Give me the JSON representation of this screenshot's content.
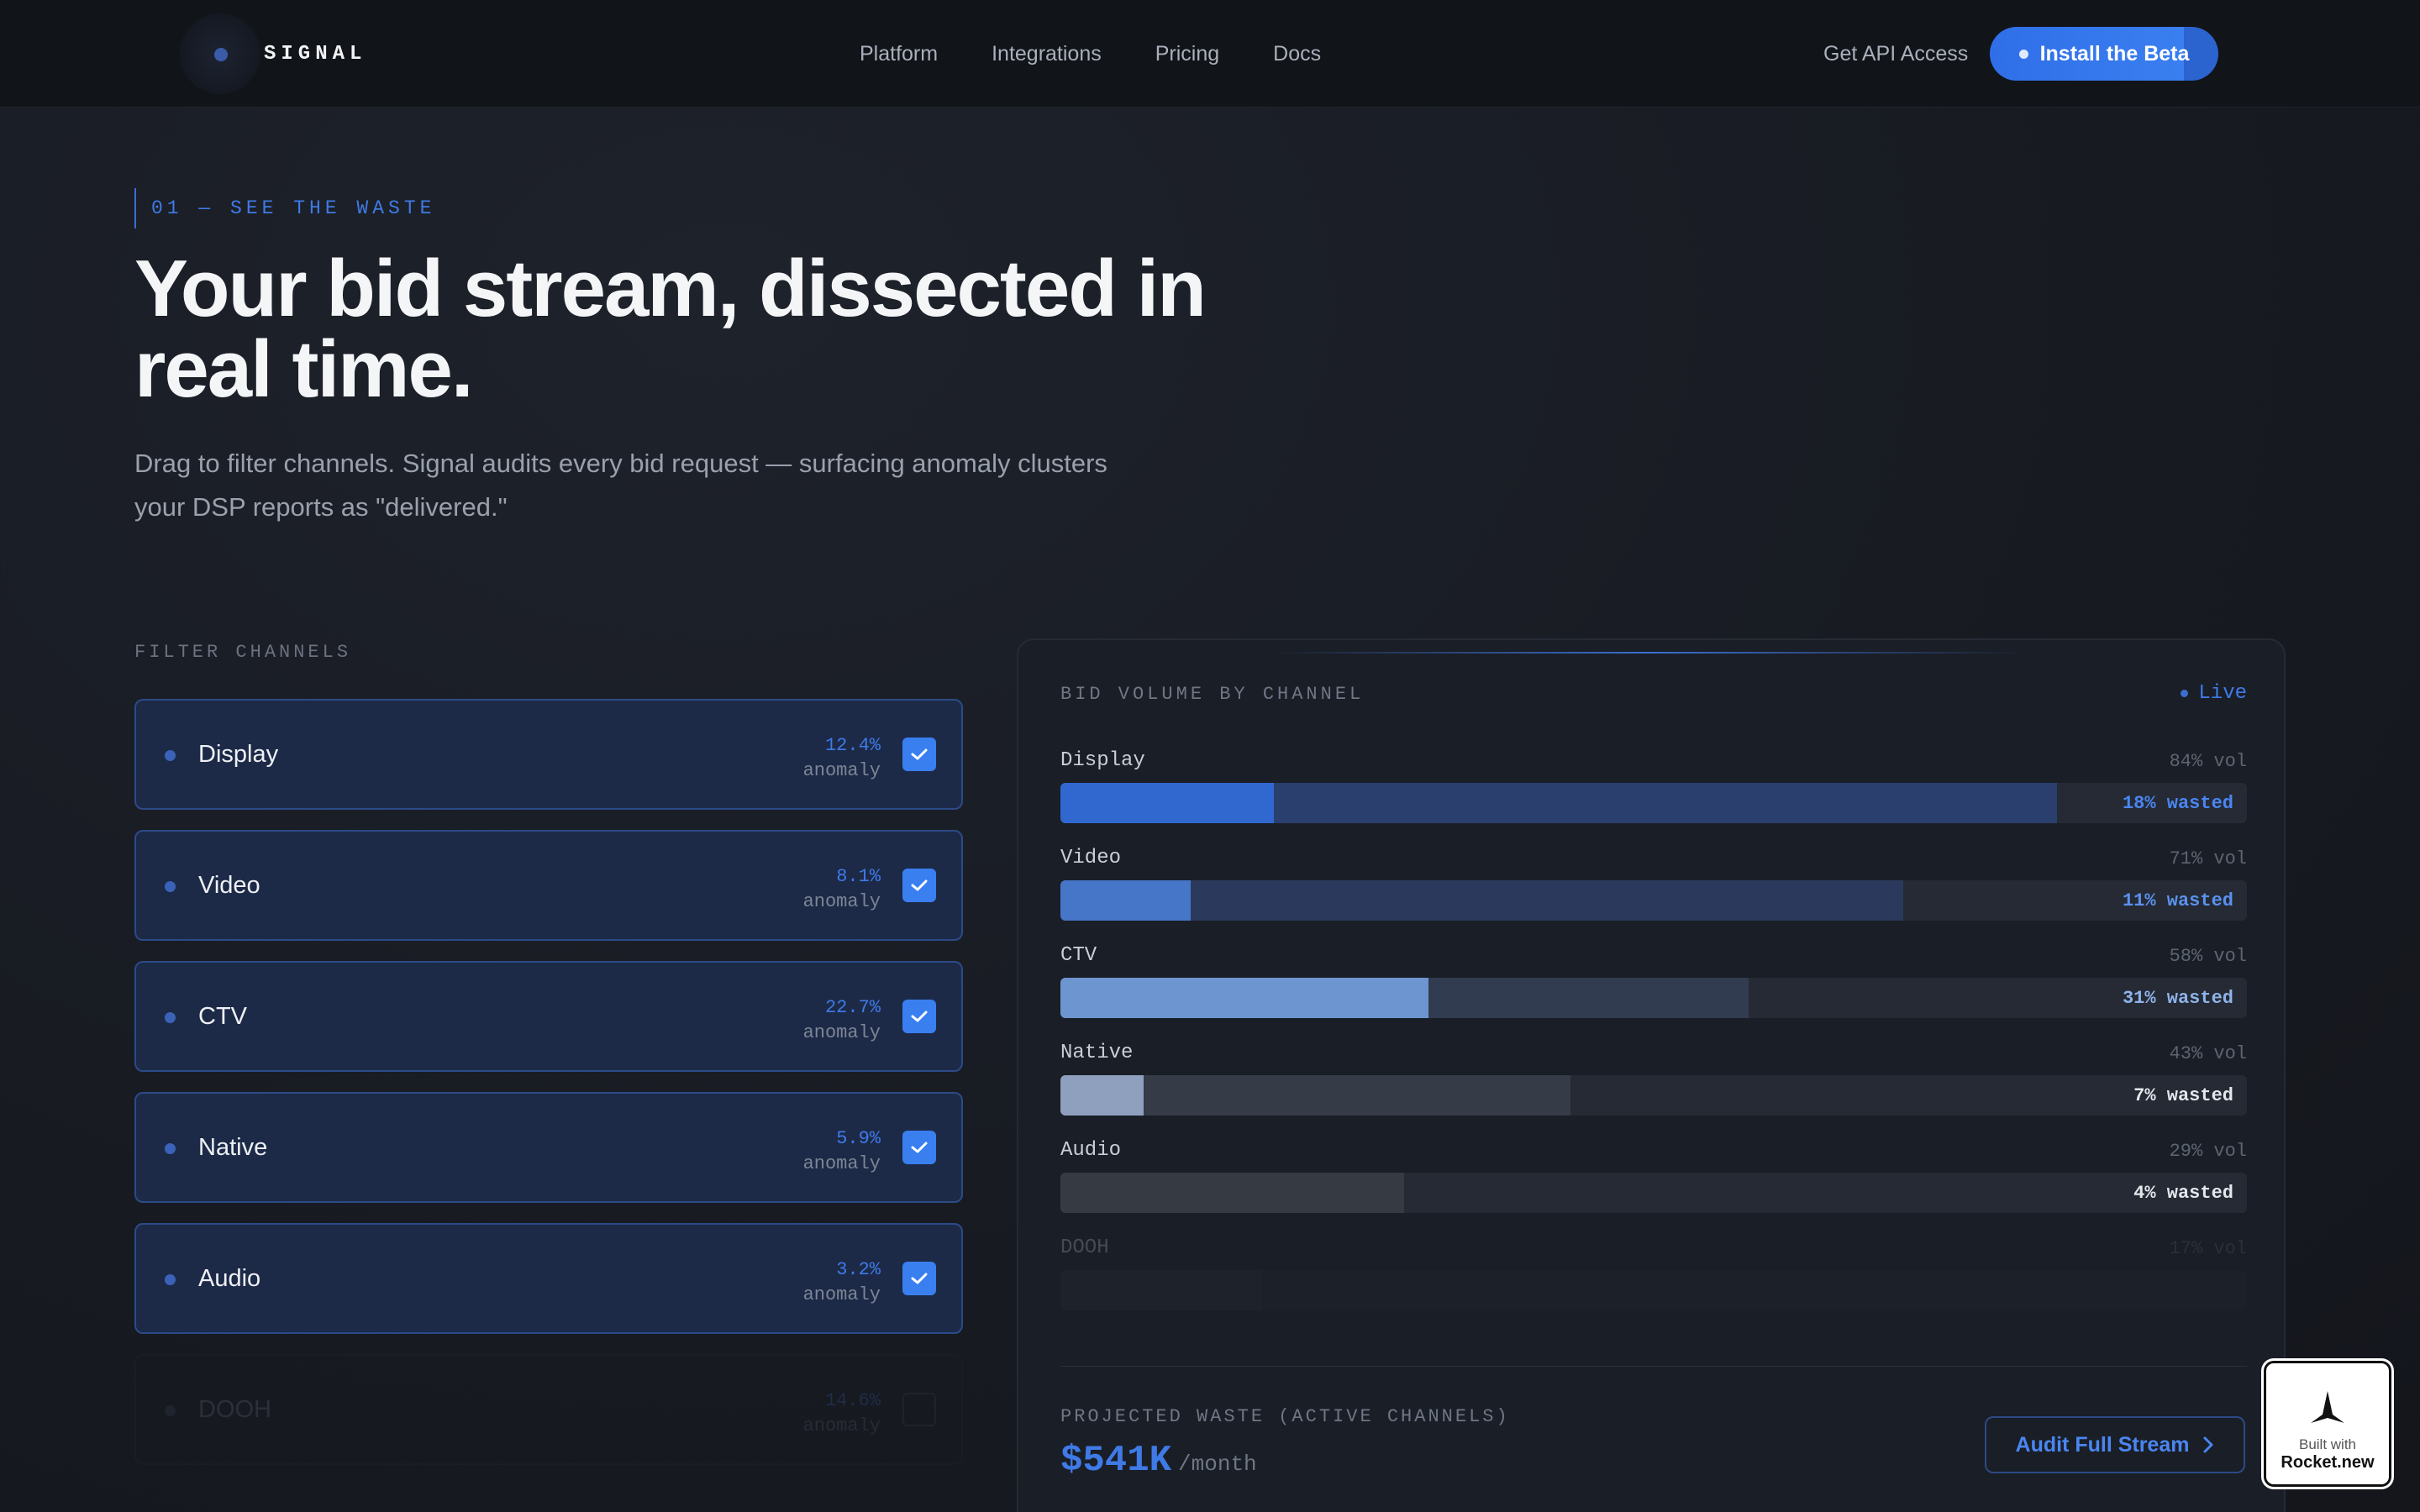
{
  "nav": {
    "logo_text": "SIGNAL",
    "links": [
      "Platform",
      "Integrations",
      "Pricing",
      "Docs"
    ],
    "api_link": "Get API Access",
    "cta": "Install the Beta"
  },
  "hero": {
    "eyebrow": "01 — SEE THE WASTE",
    "title": "Your bid stream, dissected in real time.",
    "subtitle": "Drag to filter channels. Signal audits every bid request — surfacing anomaly clusters your DSP reports as \"delivered.\""
  },
  "filter": {
    "label": "FILTER CHANNELS",
    "channels": [
      {
        "name": "Display",
        "anomaly": "12.4%",
        "anomaly_label": "anomaly",
        "checked": true
      },
      {
        "name": "Video",
        "anomaly": "8.1%",
        "anomaly_label": "anomaly",
        "checked": true
      },
      {
        "name": "CTV",
        "anomaly": "22.7%",
        "anomaly_label": "anomaly",
        "checked": true
      },
      {
        "name": "Native",
        "anomaly": "5.9%",
        "anomaly_label": "anomaly",
        "checked": true
      },
      {
        "name": "Audio",
        "anomaly": "3.2%",
        "anomaly_label": "anomaly",
        "checked": true
      },
      {
        "name": "DOOH",
        "anomaly": "14.6%",
        "anomaly_label": "anomaly",
        "checked": false
      }
    ]
  },
  "panel": {
    "title": "BID VOLUME BY CHANNEL",
    "live": "Live",
    "bars": [
      {
        "name": "Display",
        "vol_label": "84% vol",
        "volume": 0.84,
        "waste": 0.18,
        "wasted_label": "18% wasted",
        "active": true,
        "vol_color": "#2a3f6e",
        "waste_color": "#3168cf",
        "label_color": "#4a86f2"
      },
      {
        "name": "Video",
        "vol_label": "71% vol",
        "volume": 0.71,
        "waste": 0.11,
        "wasted_label": "11% wasted",
        "active": true,
        "vol_color": "#2b3a5c",
        "waste_color": "#4676c8",
        "label_color": "#5a92f0"
      },
      {
        "name": "CTV",
        "vol_label": "58% vol",
        "volume": 0.58,
        "waste": 0.31,
        "wasted_label": "31% wasted",
        "active": true,
        "vol_color": "#323c50",
        "waste_color": "#6d96d0",
        "label_color": "#8fb3ea"
      },
      {
        "name": "Native",
        "vol_label": "43% vol",
        "volume": 0.43,
        "waste": 0.07,
        "wasted_label": "7% wasted",
        "active": true,
        "vol_color": "#353b47",
        "waste_color": "#8ea0bd",
        "label_color": "#e4e7ec"
      },
      {
        "name": "Audio",
        "vol_label": "29% vol",
        "volume": 0.29,
        "waste": 0.04,
        "wasted_label": "4% wasted",
        "active": true,
        "vol_color": "#363a43",
        "waste_color": "#363a43",
        "label_color": "#e4e7ec"
      },
      {
        "name": "DOOH",
        "vol_label": "17% vol",
        "volume": 0.17,
        "waste": 0.0,
        "wasted_label": "",
        "active": false,
        "vol_color": "#2a2e37",
        "waste_color": "#2a2e37",
        "label_color": "#6f7685"
      }
    ],
    "projected_label": "PROJECTED WASTE (ACTIVE CHANNELS)",
    "projected_amount": "$541K",
    "projected_unit": "/month",
    "audit_button": "Audit Full Stream"
  },
  "badge": {
    "line1": "Built with",
    "line2": "Rocket.new"
  }
}
